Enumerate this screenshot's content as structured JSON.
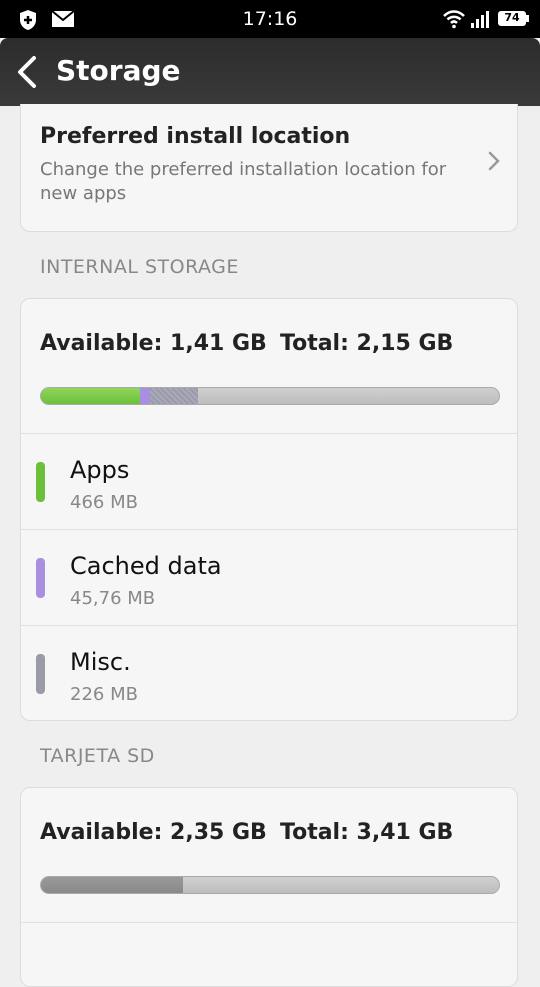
{
  "status_bar": {
    "time": "17:16",
    "battery": "74"
  },
  "header": {
    "title": "Storage"
  },
  "preferred": {
    "title": "Preferred install location",
    "subtitle": "Change the preferred installation location for new apps"
  },
  "internal": {
    "header": "INTERNAL STORAGE",
    "available": "Available: 1,41 GB",
    "total": "Total: 2,15 GB",
    "usage_fraction": {
      "apps": 0.217,
      "cached": 0.021,
      "misc": 0.105
    },
    "items": [
      {
        "name": "Apps",
        "size": "466 MB",
        "color": "#6cbf3a"
      },
      {
        "name": "Cached data",
        "size": "45,76 MB",
        "color": "#a98fe0"
      },
      {
        "name": "Misc.",
        "size": "226 MB",
        "color": "#9a9aa8"
      }
    ]
  },
  "sd": {
    "header": "TARJETA SD",
    "available": "Available: 2,35 GB",
    "total": "Total: 3,41 GB",
    "used_fraction": 0.311,
    "used_color": "#8a8a8a"
  },
  "colors": {
    "apps": "#6cbf3a",
    "cached": "#a98fe0",
    "misc": "#9a9aa8"
  }
}
